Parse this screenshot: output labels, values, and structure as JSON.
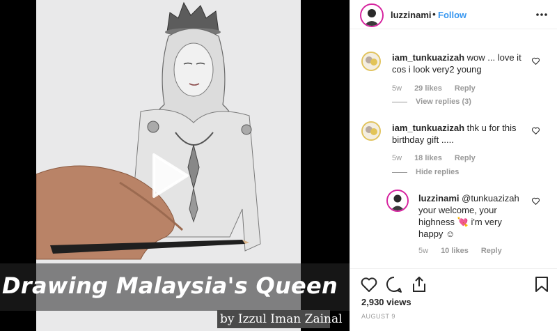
{
  "video": {
    "title": "Drawing Malaysia's Queen",
    "byline": "by Izzul Iman Zainal"
  },
  "post": {
    "author": "luzzinami",
    "separator": "•",
    "follow_label": "Follow",
    "views": "2,930 views",
    "date": "AUGUST 9"
  },
  "comments": [
    {
      "user": "iam_tunkuazizah",
      "text": "wow ... love it cos i look very2 young",
      "time": "5w",
      "likes": "29 likes",
      "reply": "Reply",
      "thread": "View replies (3)"
    },
    {
      "user": "iam_tunkuazizah",
      "text": "thk u for this birthday gift .....",
      "time": "5w",
      "likes": "18 likes",
      "reply": "Reply",
      "thread": "Hide replies"
    }
  ],
  "reply": {
    "user": "luzzinami",
    "text": "@tunkuazizah your welcome, your highness 💘 i'm very happy ☺",
    "time": "5w",
    "likes": "10 likes",
    "reply": "Reply"
  },
  "colors": {
    "accent": "#3897f0",
    "muted": "#999999",
    "text": "#262626",
    "story_ring": "#d6249f"
  },
  "icons": [
    "play-icon",
    "more-icon",
    "heart-icon",
    "comment-icon",
    "share-icon",
    "bookmark-icon"
  ]
}
